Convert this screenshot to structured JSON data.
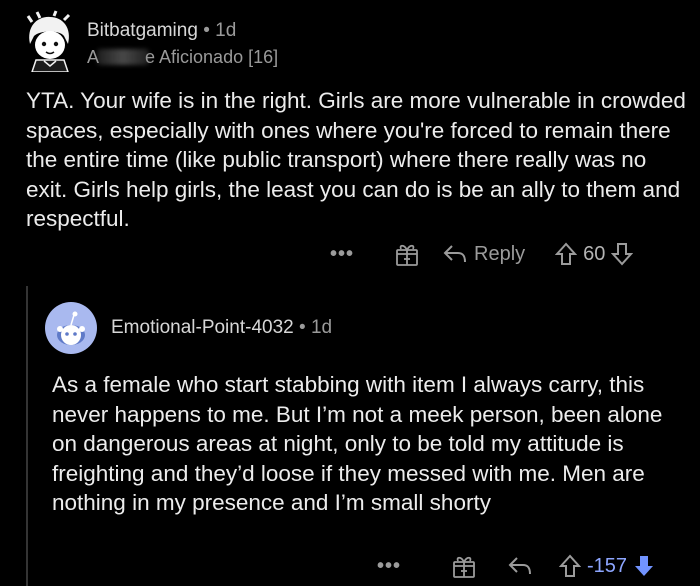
{
  "comment": {
    "username": "Bitbatgaming",
    "separator": "•",
    "age": "1d",
    "flair_prefix": "A",
    "flair_suffix": "e Aficionado [16]",
    "body": "YTA. Your wife is in the right. Girls are more vulnerable in crowded spaces, especially with ones where you're forced to remain there the entire time (like public transport) where there really was no exit. Girls help girls, the least you can do is be an ally to them and respectful.",
    "actions": {
      "more": "•••",
      "award_icon": "gift-icon",
      "reply_icon": "reply-arrow-icon",
      "reply_label": "Reply",
      "upvote_icon": "upvote-arrow-icon",
      "score": "60",
      "downvote_icon": "downvote-arrow-icon"
    }
  },
  "reply": {
    "username": "Emotional-Point-4032",
    "separator": "•",
    "age": "1d",
    "body": "As a female who start stabbing with item I always carry, this never happens to me. But I’m not a meek person, been alone on dangerous areas at night, only to be told my attitude is freighting and they’d loose if they messed with me. Men are nothing in my presence and I’m small shorty",
    "actions": {
      "more": "•••",
      "award_icon": "gift-icon",
      "reply_icon": "reply-arrow-icon",
      "upvote_icon": "upvote-arrow-icon",
      "score": "-157",
      "downvote_icon": "downvote-arrow-icon"
    }
  },
  "colors": {
    "background": "#000000",
    "text": "#ececec",
    "muted": "#9a9a9a",
    "downvote_active": "#7193ff",
    "default_avatar_bg": "#a9b9ef"
  }
}
